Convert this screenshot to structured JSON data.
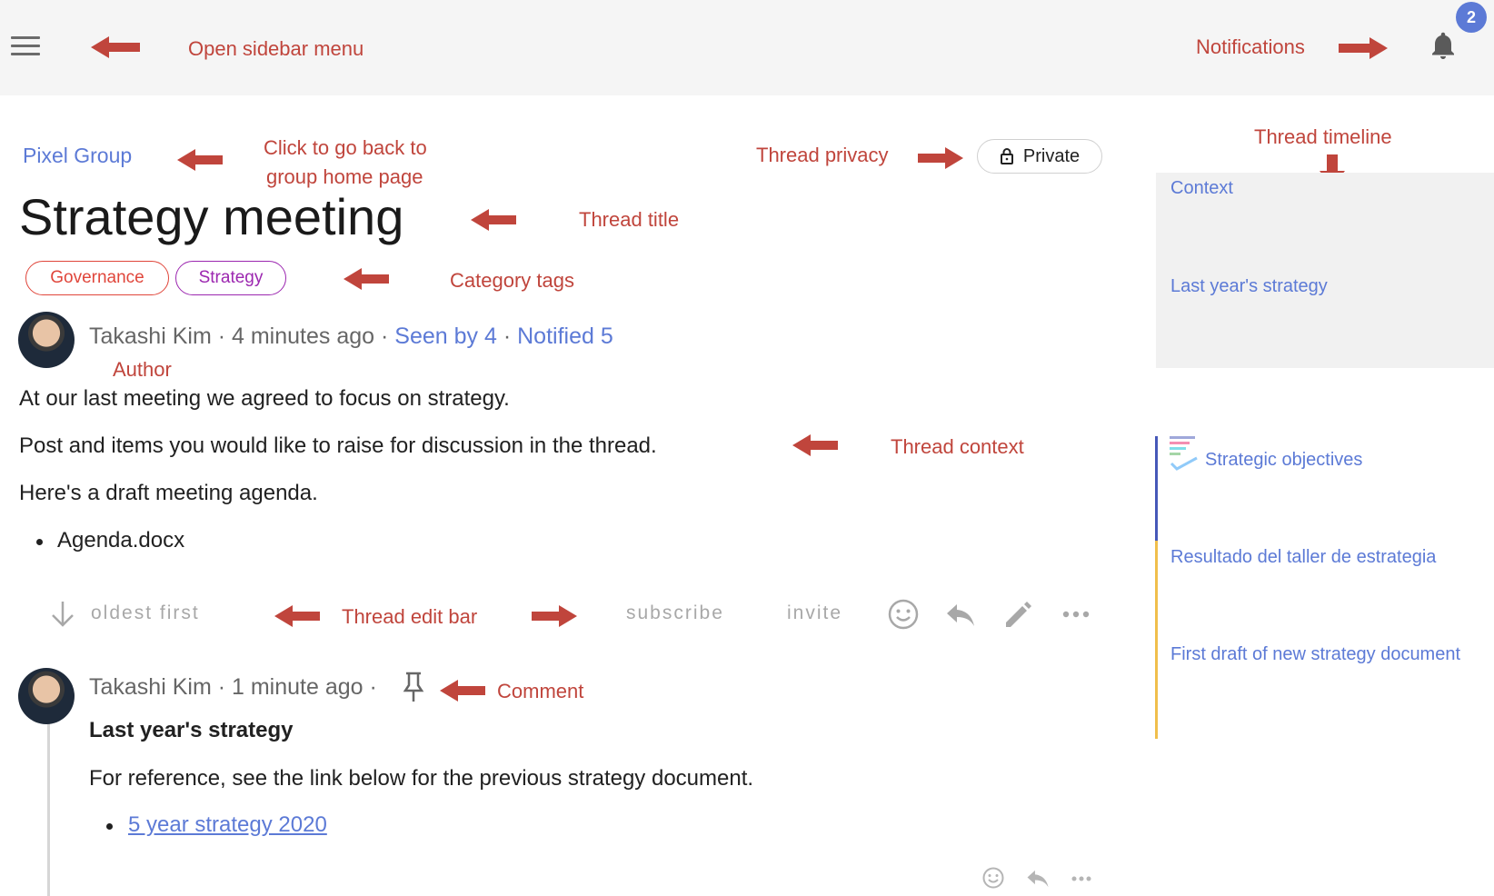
{
  "topbar": {
    "notification_count": "2"
  },
  "annotations": {
    "open_sidebar_menu": "Open sidebar menu",
    "notifications": "Notifications",
    "click_back_line1": "Click to go back to",
    "click_back_line2": "group home page",
    "thread_privacy": "Thread privacy",
    "thread_timeline": "Thread timeline",
    "thread_title": "Thread title",
    "category_tags": "Category tags",
    "author": "Author",
    "thread_context": "Thread context",
    "thread_edit_bar": "Thread edit bar",
    "comment": "Comment"
  },
  "thread": {
    "group_name": "Pixel Group",
    "privacy_label": "Private",
    "title": "Strategy meeting",
    "tags": [
      {
        "label": "Governance",
        "color": "#e0463b"
      },
      {
        "label": "Strategy",
        "color": "#9c27b0"
      }
    ],
    "author": "Takashi Kim",
    "time": "4 minutes ago",
    "separator": "·",
    "seen_by": "Seen by 4",
    "notified": "Notified 5",
    "context_lines": [
      "At our last meeting we agreed to focus on strategy.",
      "Post and items you would like to raise for discussion in the thread.",
      "Here's a draft meeting agenda."
    ],
    "attachment": "Agenda.docx"
  },
  "actionbar": {
    "sort_label": "oldest first",
    "subscribe_label": "subscribe",
    "invite_label": "invite"
  },
  "comment": {
    "author": "Takashi Kim",
    "time": "1 minute ago",
    "heading": "Last year's strategy",
    "text": "For reference, see the link below for the previous strategy document.",
    "link": "5 year strategy 2020"
  },
  "timeline": {
    "items": [
      "Context",
      "Last year's strategy",
      "Strategic objectives",
      "Resultado del taller de estrategia",
      "First draft of new strategy document"
    ]
  },
  "colors": {
    "accent_blue": "#5c7ad6",
    "annotation_red": "#c0453c",
    "timeline_blue": "#4658b8",
    "timeline_yellow": "#f0bf4c"
  }
}
